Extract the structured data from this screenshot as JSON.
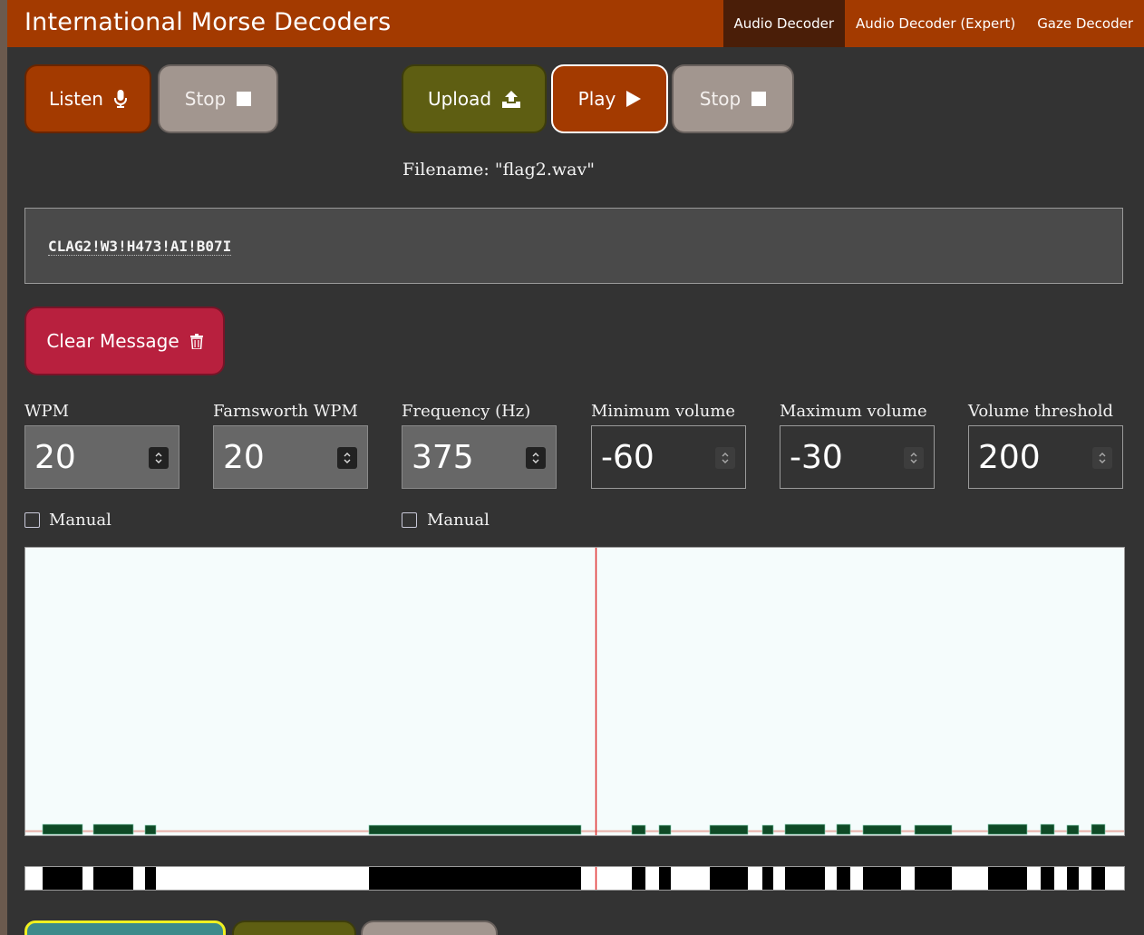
{
  "app_title": "International Morse Decoders",
  "nav": {
    "items": [
      {
        "label": "Audio Decoder",
        "active": true
      },
      {
        "label": "Audio Decoder (Expert)",
        "active": false
      },
      {
        "label": "Gaze Decoder",
        "active": false
      }
    ]
  },
  "listen_controls": {
    "listen_label": "Listen",
    "listen_icon": "microphone-icon",
    "stop_label": "Stop",
    "stop_icon": "stop-square-icon"
  },
  "file_controls": {
    "upload_label": "Upload",
    "upload_icon": "upload-icon",
    "play_label": "Play",
    "play_icon": "play-icon",
    "stop_label": "Stop",
    "stop_icon": "stop-square-icon",
    "filename_text": "Filename: \"flag2.wav\""
  },
  "decoded_message": "CLAG2!W3!H473!AI!B07I",
  "clear_button": {
    "label": "Clear Message",
    "icon": "trash-icon"
  },
  "settings": {
    "wpm": {
      "label": "WPM",
      "value": "20"
    },
    "farnsworth_wpm": {
      "label": "Farnsworth WPM",
      "value": "20"
    },
    "frequency": {
      "label": "Frequency (Hz)",
      "value": "375"
    },
    "min_volume": {
      "label": "Minimum volume",
      "value": "-60"
    },
    "max_volume": {
      "label": "Maximum volume",
      "value": "-30"
    },
    "volume_threshold": {
      "label": "Volume threshold",
      "value": "200"
    }
  },
  "manual_wpm": {
    "label": "Manual",
    "checked": false
  },
  "manual_frequency": {
    "label": "Manual",
    "checked": false
  },
  "colors": {
    "brand": "#a33a00",
    "nav_active": "#4a1e08",
    "olive": "#5e5e12",
    "grey_button": "#a2968f",
    "crimson": "#b8203e",
    "signal": "#0f4a26",
    "playhead": "#e03030"
  }
}
